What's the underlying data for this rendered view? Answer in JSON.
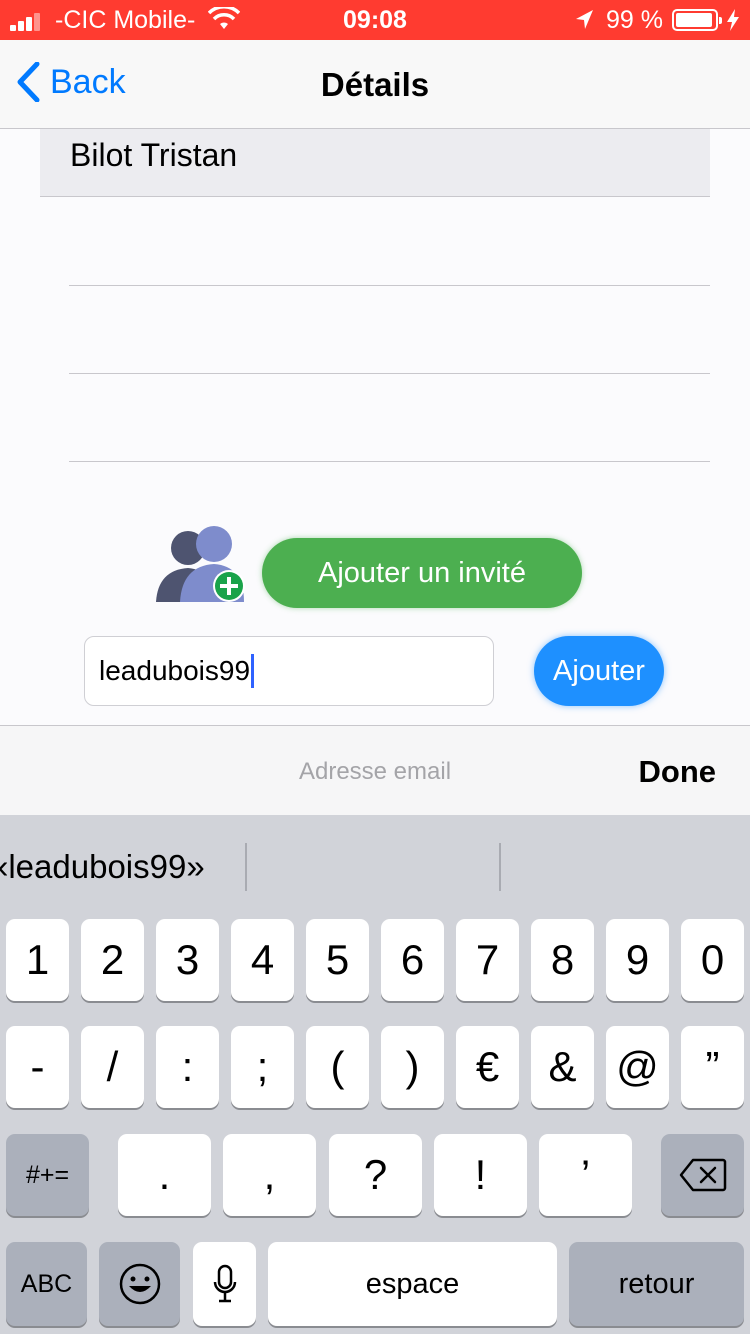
{
  "status_bar": {
    "carrier": "-CIC Mobile-",
    "time": "09:08",
    "battery": "99 %"
  },
  "nav": {
    "back_label": "Back",
    "title": "Détails"
  },
  "list": {
    "items": [
      "Bilot Tristan",
      "",
      "",
      ""
    ]
  },
  "guest": {
    "add_button_label": "Ajouter un invité",
    "email_value": "leadubois99",
    "add_label": "Ajouter"
  },
  "toolbar": {
    "placeholder": "Adresse email",
    "done_label": "Done"
  },
  "keyboard": {
    "suggestion": "«leadubois99»",
    "row1": [
      "1",
      "2",
      "3",
      "4",
      "5",
      "6",
      "7",
      "8",
      "9",
      "0"
    ],
    "row2": [
      "-",
      "/",
      ":",
      ";",
      "(",
      ")",
      "€",
      "&",
      "@",
      "”"
    ],
    "row3_shift": "#+=",
    "row3": [
      ".",
      ",",
      "?",
      "!",
      "’"
    ],
    "abc_label": "ABC",
    "space_label": "espace",
    "return_label": "retour"
  },
  "colors": {
    "status_bar": "#ff3b30",
    "ios_blue": "#007aff",
    "add_guest_green": "#4caf50",
    "ajouter_blue": "#1e90ff"
  }
}
